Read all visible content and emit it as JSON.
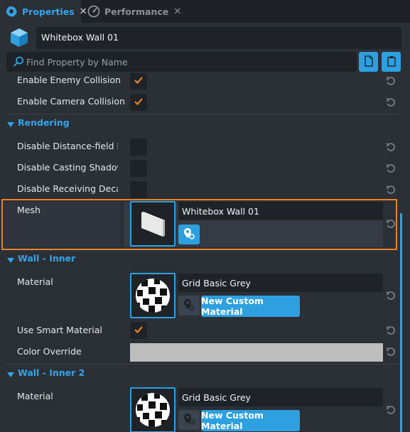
{
  "tabs": [
    {
      "label": "Properties",
      "icon": "gear-icon",
      "active": true
    },
    {
      "label": "Performance",
      "icon": "gauge-icon",
      "active": false
    }
  ],
  "header": {
    "object_name": "Whitebox Wall 01",
    "object_icon": "cube-icon",
    "search_placeholder": "Find Property by Name"
  },
  "rows": {
    "enable_enemy_collision": {
      "label": "Enable Enemy Collision",
      "checked": true
    },
    "enable_camera_collision": {
      "label": "Enable Camera Collision",
      "checked": true
    },
    "disable_distance_field": {
      "label": "Disable Distance-field Lighting",
      "checked": false
    },
    "disable_casting_shadows": {
      "label": "Disable Casting Shadows",
      "checked": false
    },
    "disable_receiving_decals": {
      "label": "Disable Receiving Decals",
      "checked": false
    }
  },
  "sections": {
    "rendering": "Rendering",
    "wall_inner": "Wall - Inner",
    "wall_inner_2": "Wall - Inner 2"
  },
  "mesh": {
    "label": "Mesh",
    "value": "Whitebox Wall 01"
  },
  "wall_inner": {
    "material_label": "Material",
    "material_value": "Grid Basic Grey",
    "new_material_button": "New Custom Material",
    "smart_material_label": "Use Smart Material",
    "smart_material_checked": true,
    "color_override_label": "Color Override",
    "color_override_value": "#bdbdbd"
  },
  "wall_inner_2": {
    "material_label": "Material",
    "material_value": "Grid Basic Grey",
    "new_material_button": "New Custom Material"
  },
  "colors": {
    "accent": "#2ea0df",
    "highlight": "#e9822c",
    "check": "#e9822c"
  }
}
